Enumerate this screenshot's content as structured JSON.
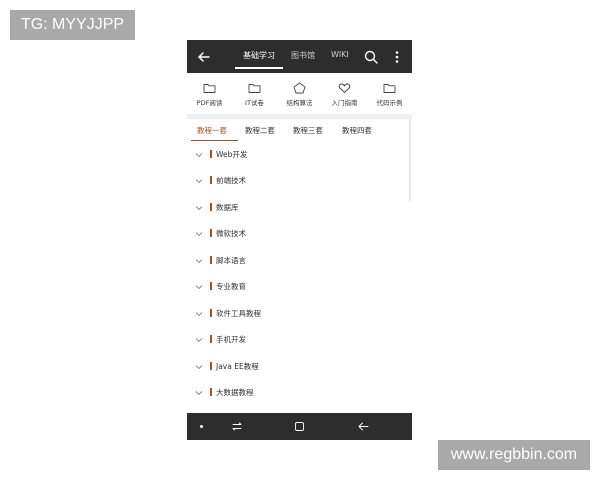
{
  "watermarks": {
    "top_left": "TG: MYYJJPP",
    "bottom_right": "www.regbbin.com"
  },
  "topbar": {
    "tabs": [
      {
        "label": "基础学习",
        "active": true
      },
      {
        "label": "图书馆",
        "active": false
      },
      {
        "label": "WIKI",
        "active": false
      }
    ],
    "icons": [
      "back-arrow-icon",
      "search-icon",
      "more-vertical-icon"
    ]
  },
  "tools": [
    {
      "label": "PDF阅读",
      "icon": "folder-icon"
    },
    {
      "label": "IT试卷",
      "icon": "folder-icon"
    },
    {
      "label": "结构算法",
      "icon": "pentagon-icon"
    },
    {
      "label": "入门指南",
      "icon": "heart-icon"
    },
    {
      "label": "代码示例",
      "icon": "folder-icon"
    }
  ],
  "subtabs": [
    {
      "label": "教程一套",
      "active": true
    },
    {
      "label": "教程二套",
      "active": false
    },
    {
      "label": "教程三套",
      "active": false
    },
    {
      "label": "教程四套",
      "active": false
    }
  ],
  "list": [
    "Web开发",
    "前端技术",
    "数据库",
    "微软技术",
    "脚本语言",
    "专业教育",
    "软件工具教程",
    "手机开发",
    "Java EE教程",
    "大数据教程"
  ],
  "colors": {
    "accent": "#a0522d",
    "dark_bar": "#2d2d2d",
    "watermark_bg": "#a9a9a9"
  }
}
